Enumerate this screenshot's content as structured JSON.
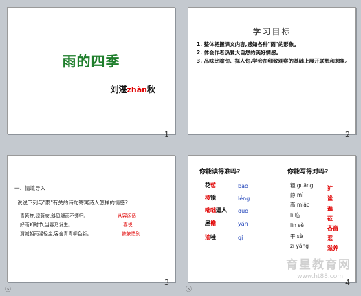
{
  "slides": [
    {
      "number": "1",
      "title": "雨的四季",
      "author": "刘湛",
      "author_pinyin": "zhàn",
      "author_tail": "秋"
    },
    {
      "number": "2",
      "heading": "学习目标",
      "items": [
        "1. 整体把握课文内容,感知各种\"雨\"的形象。",
        "2. 体会作者热爱大自然的美好情感。",
        "3. 品味比喻句、拟人句,学会在细致观察的基础上展开联想和想象。"
      ]
    },
    {
      "number": "3",
      "section": "一、情境导入",
      "question": "说说下列与\"雨\"有关的诗句寄寓诗人怎样的情感?",
      "lines": [
        "青箬笠,绿蓑衣,斜风细雨不须归。",
        "好雨知时节,当春乃发生。",
        "渭城朝雨浥轻尘,客舍青青柳色新。"
      ],
      "answers": [
        "从容闲适",
        "喜悦",
        "依依惜别"
      ]
    },
    {
      "number": "4",
      "left_heading": "你能读得准吗?",
      "right_heading": "你能写得对吗?",
      "read_words": [
        {
          "pre": "花",
          "hi": "苞",
          "post": "",
          "py": "bāo"
        },
        {
          "pre": "",
          "hi": "棱",
          "post": "镜",
          "py": "léng"
        },
        {
          "pre": "",
          "hi": "咄咄",
          "post": "逼人",
          "py": "duō"
        },
        {
          "pre": "屋",
          "hi": "檐",
          "post": "",
          "py": "yán"
        },
        {
          "pre": "",
          "hi": "油",
          "post": "哇",
          "py": "qí"
        }
      ],
      "write_words": [
        "粗 guāng",
        "静 mì",
        "高 miǎo",
        "lì 临",
        "lìn sè",
        "干 sè",
        "zī yǎng"
      ],
      "write_answers": [
        "犷",
        "谧",
        "邈",
        "莅",
        "吝啬",
        "涩",
        "滋养"
      ],
      "watermark": "育星教育网",
      "watermark_url": "www.ht88.com"
    }
  ],
  "nav_icon": "slide-show-icon",
  "nav_icon_glyph": "ⓢ"
}
